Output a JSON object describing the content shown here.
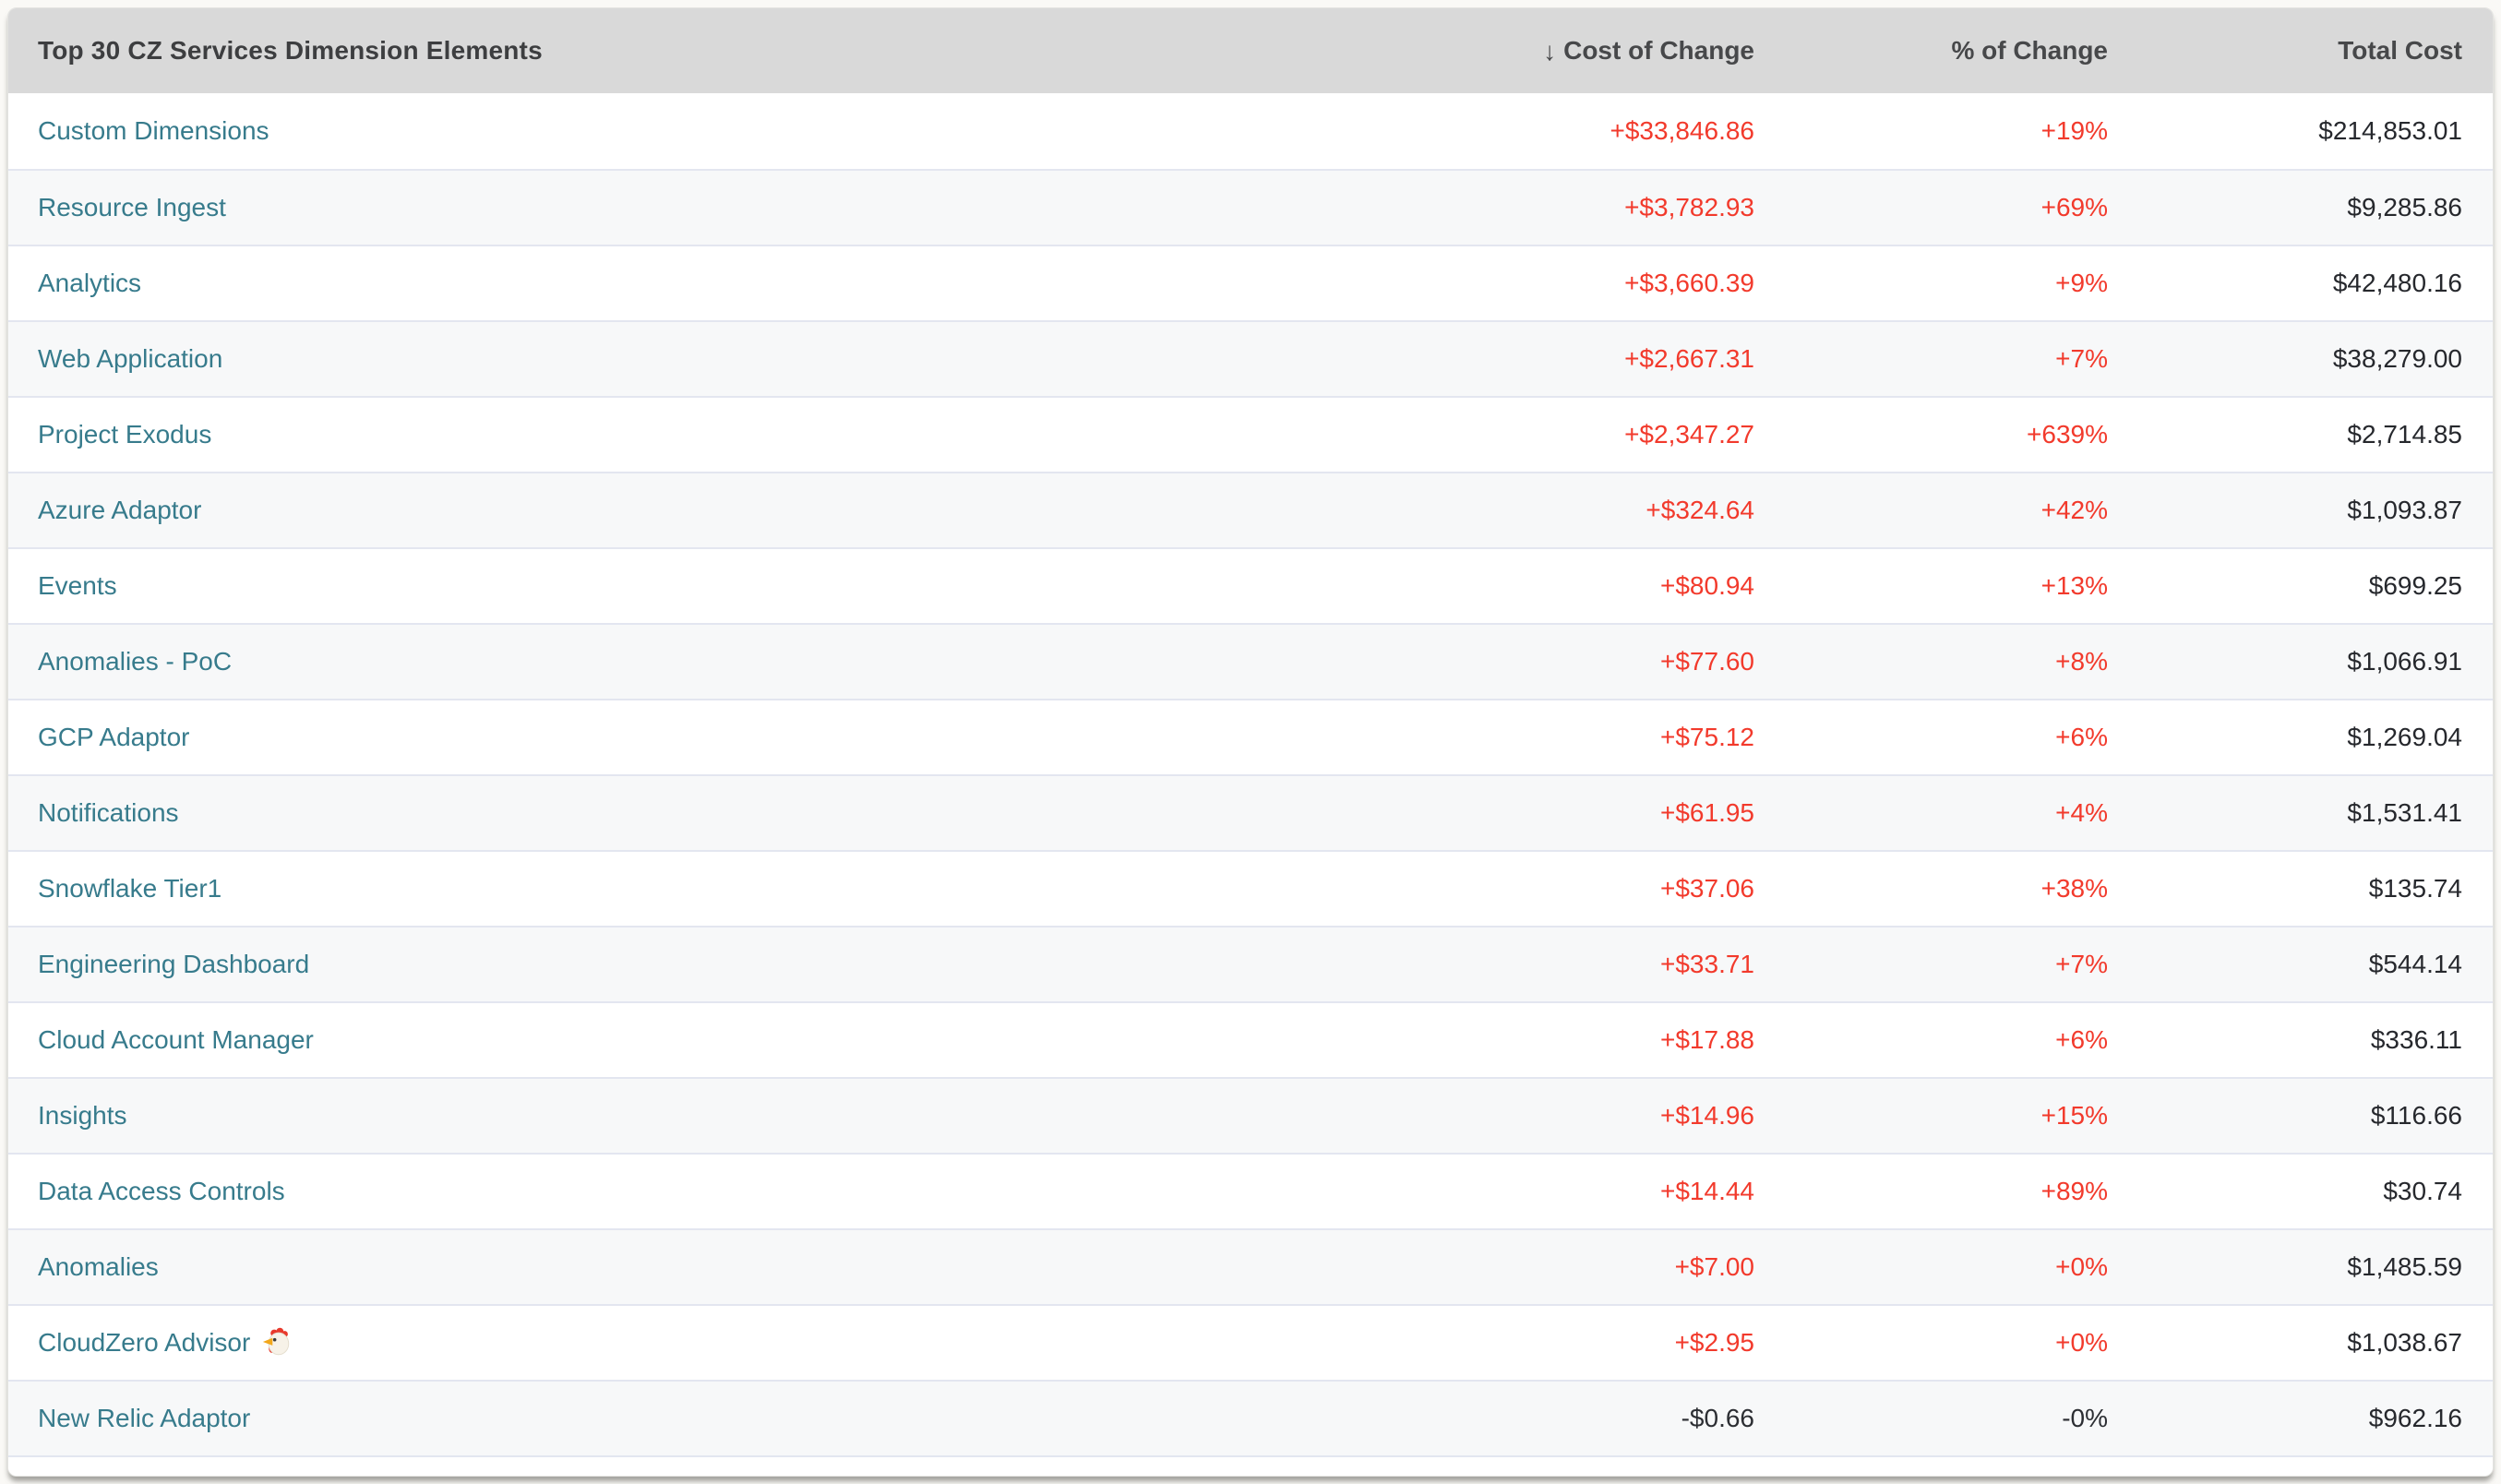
{
  "colors": {
    "page_background": "#faf9f6",
    "header_background": "#d9d9d9",
    "link_teal": "#377b8c",
    "positive_red": "#f23a2c",
    "neutral_dark": "#2c2e33",
    "row_alt_background": "#f7f8f9",
    "separator": "#e3e6f0"
  },
  "table": {
    "title": "Top 30 CZ Services Dimension Elements",
    "sort_icon": "↓",
    "sorted_column": "Cost of Change",
    "sort_direction": "descending",
    "columns": [
      {
        "label": "Cost of Change"
      },
      {
        "label": "% of Change"
      },
      {
        "label": "Total Cost"
      }
    ],
    "rows": [
      {
        "name": "Custom Dimensions",
        "cost_of_change": "+$33,846.86",
        "pct_of_change": "+19%",
        "total_cost": "$214,853.01"
      },
      {
        "name": "Resource Ingest",
        "cost_of_change": "+$3,782.93",
        "pct_of_change": "+69%",
        "total_cost": "$9,285.86"
      },
      {
        "name": "Analytics",
        "cost_of_change": "+$3,660.39",
        "pct_of_change": "+9%",
        "total_cost": "$42,480.16"
      },
      {
        "name": "Web Application",
        "cost_of_change": "+$2,667.31",
        "pct_of_change": "+7%",
        "total_cost": "$38,279.00"
      },
      {
        "name": "Project Exodus",
        "cost_of_change": "+$2,347.27",
        "pct_of_change": "+639%",
        "total_cost": "$2,714.85"
      },
      {
        "name": "Azure Adaptor",
        "cost_of_change": "+$324.64",
        "pct_of_change": "+42%",
        "total_cost": "$1,093.87"
      },
      {
        "name": "Events",
        "cost_of_change": "+$80.94",
        "pct_of_change": "+13%",
        "total_cost": "$699.25"
      },
      {
        "name": "Anomalies - PoC",
        "cost_of_change": "+$77.60",
        "pct_of_change": "+8%",
        "total_cost": "$1,066.91"
      },
      {
        "name": "GCP Adaptor",
        "cost_of_change": "+$75.12",
        "pct_of_change": "+6%",
        "total_cost": "$1,269.04"
      },
      {
        "name": "Notifications",
        "cost_of_change": "+$61.95",
        "pct_of_change": "+4%",
        "total_cost": "$1,531.41"
      },
      {
        "name": "Snowflake Tier1",
        "cost_of_change": "+$37.06",
        "pct_of_change": "+38%",
        "total_cost": "$135.74"
      },
      {
        "name": "Engineering Dashboard",
        "cost_of_change": "+$33.71",
        "pct_of_change": "+7%",
        "total_cost": "$544.14"
      },
      {
        "name": "Cloud Account Manager",
        "cost_of_change": "+$17.88",
        "pct_of_change": "+6%",
        "total_cost": "$336.11"
      },
      {
        "name": "Insights",
        "cost_of_change": "+$14.96",
        "pct_of_change": "+15%",
        "total_cost": "$116.66"
      },
      {
        "name": "Data Access Controls",
        "cost_of_change": "+$14.44",
        "pct_of_change": "+89%",
        "total_cost": "$30.74"
      },
      {
        "name": "Anomalies",
        "cost_of_change": "+$7.00",
        "pct_of_change": "+0%",
        "total_cost": "$1,485.59"
      },
      {
        "name": "CloudZero Advisor",
        "icon": "chicken-icon",
        "cost_of_change": "+$2.95",
        "pct_of_change": "+0%",
        "total_cost": "$1,038.67"
      },
      {
        "name": "New Relic Adaptor",
        "cost_of_change": "-$0.66",
        "pct_of_change": "-0%",
        "total_cost": "$962.16"
      }
    ]
  }
}
